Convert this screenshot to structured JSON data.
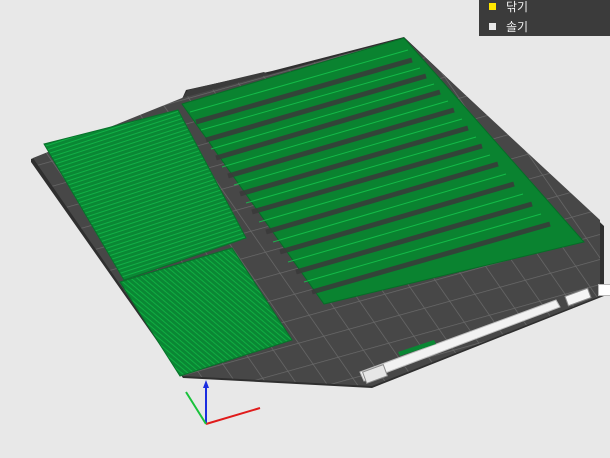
{
  "legend": {
    "items": [
      {
        "label": "닦기",
        "color": "#ffe600"
      },
      {
        "label": "솔기",
        "color": "#e8e8e8"
      }
    ]
  },
  "scene": {
    "background": "#e8e8e8",
    "bed_color": "#4a4a4a",
    "grid_color": "#6a6a6a",
    "print_color": "#0b8a35",
    "print_line_color": "#0fbf46"
  },
  "axes": {
    "x_color": "#e01b1b",
    "y_color": "#19c23b",
    "z_color": "#1b2ee0"
  }
}
